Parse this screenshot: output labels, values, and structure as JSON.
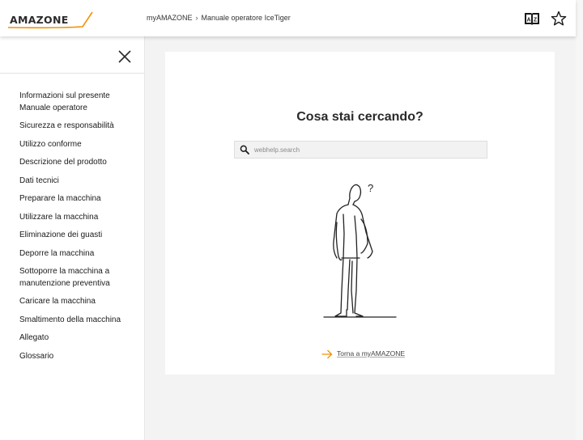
{
  "header": {
    "logo_text": "AMAZONE",
    "breadcrumb": [
      "myAMAZONE",
      "Manuale operatore IceTiger"
    ],
    "breadcrumb_separator": "›",
    "glossary_icon_label": "A Z"
  },
  "sidebar": {
    "items": [
      "Informazioni sul presente Manuale operatore",
      "Sicurezza e responsabilità",
      "Utilizzo conforme",
      "Descrizione del prodotto",
      "Dati tecnici",
      "Preparare la macchina",
      "Utilizzare la macchina",
      "Eliminazione dei guasti",
      "Deporre la macchina",
      "Sottoporre la macchina a manutenzione preventiva",
      "Caricare la macchina",
      "Smaltimento della macchina",
      "Allegato",
      "Glossario"
    ]
  },
  "main": {
    "title": "Cosa stai cercando?",
    "search_placeholder": "webhelp.search",
    "question_mark": "?",
    "back_link": "Torna a myAMAZONE"
  },
  "colors": {
    "accent_orange": "#f39200",
    "text_dark": "#222222",
    "page_background": "#f3f3f3",
    "card_background": "#ffffff"
  },
  "icons": [
    "amazone-logo-swoosh",
    "glossary-book-icon",
    "star-icon",
    "close-icon",
    "search-icon",
    "arrow-right-icon"
  ]
}
